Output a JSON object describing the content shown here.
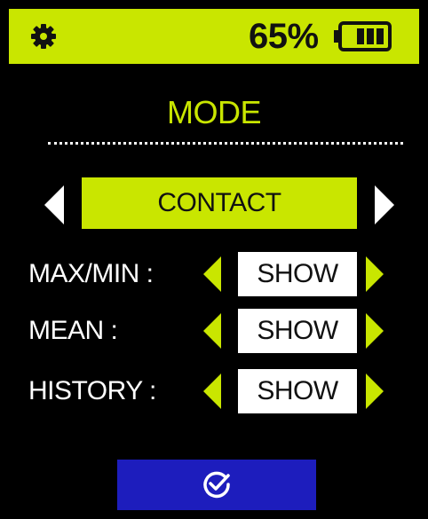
{
  "status_bar": {
    "settings_icon": "gear-icon",
    "battery_percent": "65%",
    "battery_level": 0.65,
    "battery_icon": "battery-icon"
  },
  "screen": {
    "title": "MODE",
    "mode_value": "CONTACT"
  },
  "settings_rows": [
    {
      "label": "MAX/MIN :",
      "value": "SHOW"
    },
    {
      "label": "MEAN :",
      "value": "SHOW"
    },
    {
      "label": "HISTORY :",
      "value": "SHOW"
    }
  ],
  "confirm": {
    "icon": "check-circle-icon"
  },
  "colors": {
    "accent": "#c9e600",
    "background": "#000000",
    "confirm_button": "#1d1dbd",
    "text_on_dark": "#ffffff",
    "text_on_light": "#111111"
  }
}
